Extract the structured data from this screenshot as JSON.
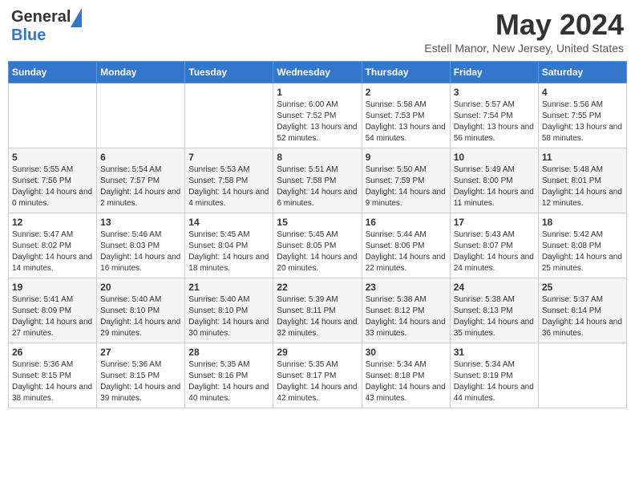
{
  "header": {
    "logo_line1": "General",
    "logo_line2": "Blue",
    "month": "May 2024",
    "location": "Estell Manor, New Jersey, United States"
  },
  "days_of_week": [
    "Sunday",
    "Monday",
    "Tuesday",
    "Wednesday",
    "Thursday",
    "Friday",
    "Saturday"
  ],
  "weeks": [
    [
      {
        "day": "",
        "info": ""
      },
      {
        "day": "",
        "info": ""
      },
      {
        "day": "",
        "info": ""
      },
      {
        "day": "1",
        "info": "Sunrise: 6:00 AM\nSunset: 7:52 PM\nDaylight: 13 hours\nand 52 minutes."
      },
      {
        "day": "2",
        "info": "Sunrise: 5:58 AM\nSunset: 7:53 PM\nDaylight: 13 hours\nand 54 minutes."
      },
      {
        "day": "3",
        "info": "Sunrise: 5:57 AM\nSunset: 7:54 PM\nDaylight: 13 hours\nand 56 minutes."
      },
      {
        "day": "4",
        "info": "Sunrise: 5:56 AM\nSunset: 7:55 PM\nDaylight: 13 hours\nand 58 minutes."
      }
    ],
    [
      {
        "day": "5",
        "info": "Sunrise: 5:55 AM\nSunset: 7:56 PM\nDaylight: 14 hours\nand 0 minutes."
      },
      {
        "day": "6",
        "info": "Sunrise: 5:54 AM\nSunset: 7:57 PM\nDaylight: 14 hours\nand 2 minutes."
      },
      {
        "day": "7",
        "info": "Sunrise: 5:53 AM\nSunset: 7:58 PM\nDaylight: 14 hours\nand 4 minutes."
      },
      {
        "day": "8",
        "info": "Sunrise: 5:51 AM\nSunset: 7:58 PM\nDaylight: 14 hours\nand 6 minutes."
      },
      {
        "day": "9",
        "info": "Sunrise: 5:50 AM\nSunset: 7:59 PM\nDaylight: 14 hours\nand 9 minutes."
      },
      {
        "day": "10",
        "info": "Sunrise: 5:49 AM\nSunset: 8:00 PM\nDaylight: 14 hours\nand 11 minutes."
      },
      {
        "day": "11",
        "info": "Sunrise: 5:48 AM\nSunset: 8:01 PM\nDaylight: 14 hours\nand 12 minutes."
      }
    ],
    [
      {
        "day": "12",
        "info": "Sunrise: 5:47 AM\nSunset: 8:02 PM\nDaylight: 14 hours\nand 14 minutes."
      },
      {
        "day": "13",
        "info": "Sunrise: 5:46 AM\nSunset: 8:03 PM\nDaylight: 14 hours\nand 16 minutes."
      },
      {
        "day": "14",
        "info": "Sunrise: 5:45 AM\nSunset: 8:04 PM\nDaylight: 14 hours\nand 18 minutes."
      },
      {
        "day": "15",
        "info": "Sunrise: 5:45 AM\nSunset: 8:05 PM\nDaylight: 14 hours\nand 20 minutes."
      },
      {
        "day": "16",
        "info": "Sunrise: 5:44 AM\nSunset: 8:06 PM\nDaylight: 14 hours\nand 22 minutes."
      },
      {
        "day": "17",
        "info": "Sunrise: 5:43 AM\nSunset: 8:07 PM\nDaylight: 14 hours\nand 24 minutes."
      },
      {
        "day": "18",
        "info": "Sunrise: 5:42 AM\nSunset: 8:08 PM\nDaylight: 14 hours\nand 25 minutes."
      }
    ],
    [
      {
        "day": "19",
        "info": "Sunrise: 5:41 AM\nSunset: 8:09 PM\nDaylight: 14 hours\nand 27 minutes."
      },
      {
        "day": "20",
        "info": "Sunrise: 5:40 AM\nSunset: 8:10 PM\nDaylight: 14 hours\nand 29 minutes."
      },
      {
        "day": "21",
        "info": "Sunrise: 5:40 AM\nSunset: 8:10 PM\nDaylight: 14 hours\nand 30 minutes."
      },
      {
        "day": "22",
        "info": "Sunrise: 5:39 AM\nSunset: 8:11 PM\nDaylight: 14 hours\nand 32 minutes."
      },
      {
        "day": "23",
        "info": "Sunrise: 5:38 AM\nSunset: 8:12 PM\nDaylight: 14 hours\nand 33 minutes."
      },
      {
        "day": "24",
        "info": "Sunrise: 5:38 AM\nSunset: 8:13 PM\nDaylight: 14 hours\nand 35 minutes."
      },
      {
        "day": "25",
        "info": "Sunrise: 5:37 AM\nSunset: 8:14 PM\nDaylight: 14 hours\nand 36 minutes."
      }
    ],
    [
      {
        "day": "26",
        "info": "Sunrise: 5:36 AM\nSunset: 8:15 PM\nDaylight: 14 hours\nand 38 minutes."
      },
      {
        "day": "27",
        "info": "Sunrise: 5:36 AM\nSunset: 8:15 PM\nDaylight: 14 hours\nand 39 minutes."
      },
      {
        "day": "28",
        "info": "Sunrise: 5:35 AM\nSunset: 8:16 PM\nDaylight: 14 hours\nand 40 minutes."
      },
      {
        "day": "29",
        "info": "Sunrise: 5:35 AM\nSunset: 8:17 PM\nDaylight: 14 hours\nand 42 minutes."
      },
      {
        "day": "30",
        "info": "Sunrise: 5:34 AM\nSunset: 8:18 PM\nDaylight: 14 hours\nand 43 minutes."
      },
      {
        "day": "31",
        "info": "Sunrise: 5:34 AM\nSunset: 8:19 PM\nDaylight: 14 hours\nand 44 minutes."
      },
      {
        "day": "",
        "info": ""
      }
    ]
  ]
}
